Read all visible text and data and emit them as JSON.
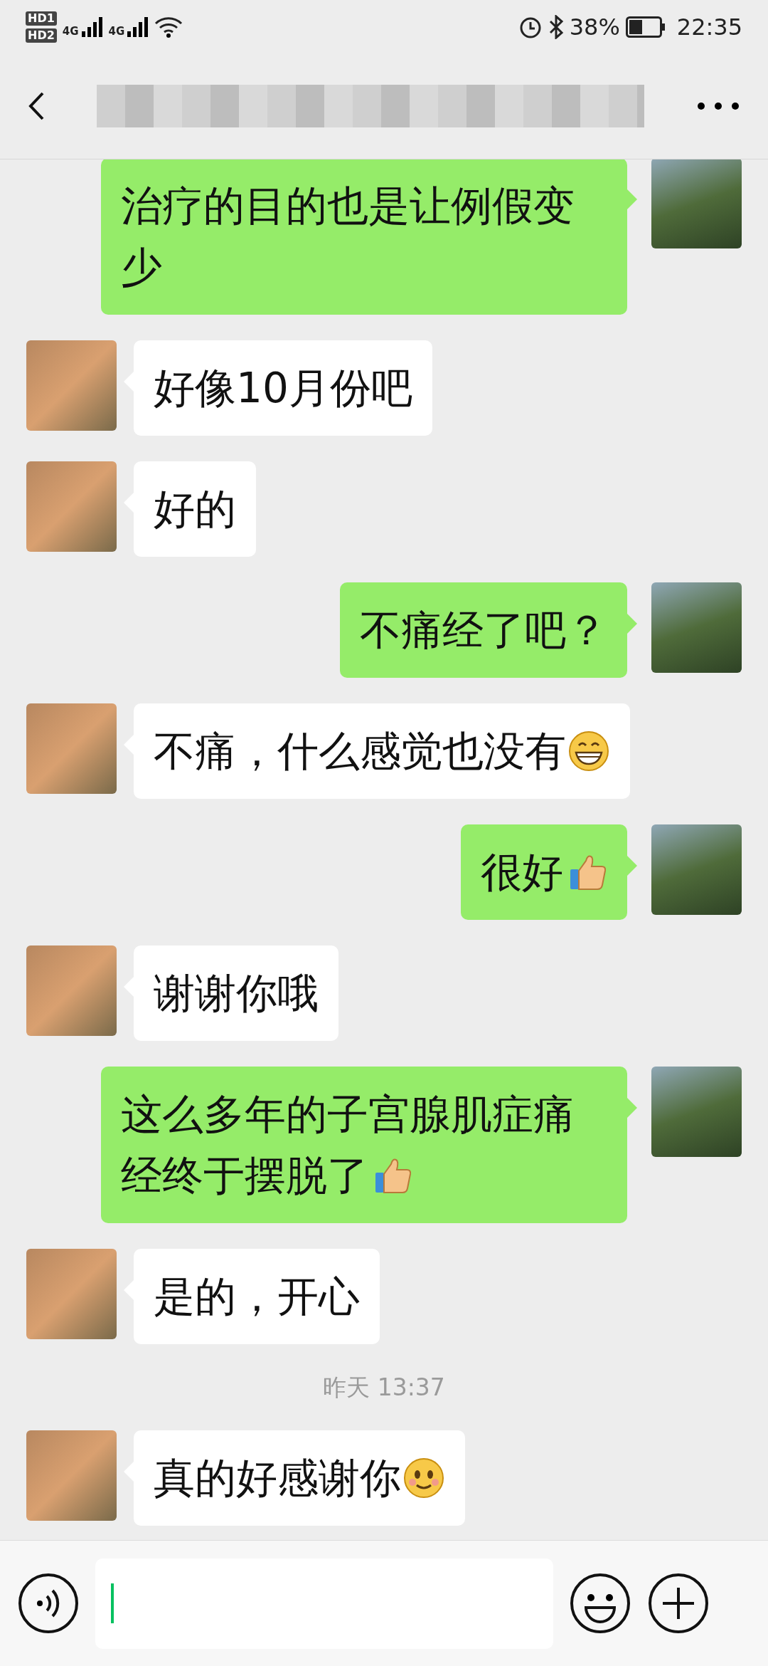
{
  "status_bar": {
    "sim_labels": [
      "HD1",
      "HD2"
    ],
    "networks": [
      "4G",
      "4G"
    ],
    "battery": "38%",
    "time": "22:35"
  },
  "messages": [
    {
      "kind": "sent",
      "parts": [
        {
          "kind": "text",
          "text": "治疗的目的也是让例假变少"
        }
      ]
    },
    {
      "kind": "received",
      "parts": [
        {
          "kind": "text",
          "text": "好像10月份吧"
        }
      ]
    },
    {
      "kind": "received",
      "parts": [
        {
          "kind": "text",
          "text": "好的"
        }
      ]
    },
    {
      "kind": "sent",
      "parts": [
        {
          "kind": "text",
          "text": "不痛经了吧？"
        }
      ]
    },
    {
      "kind": "received",
      "parts": [
        {
          "kind": "text",
          "text": "不痛，什么感觉也没有"
        },
        {
          "kind": "grin"
        }
      ]
    },
    {
      "kind": "sent",
      "parts": [
        {
          "kind": "text",
          "text": "很好"
        },
        {
          "kind": "thumbsup"
        }
      ]
    },
    {
      "kind": "received",
      "parts": [
        {
          "kind": "text",
          "text": "谢谢你哦"
        }
      ]
    },
    {
      "kind": "sent",
      "parts": [
        {
          "kind": "text",
          "text": "这么多年的子宫腺肌症痛经终于摆脱了"
        },
        {
          "kind": "thumbsup"
        }
      ]
    },
    {
      "kind": "received",
      "parts": [
        {
          "kind": "text",
          "text": "是的，开心"
        }
      ]
    },
    {
      "kind": "time",
      "text": "昨天 13:37"
    },
    {
      "kind": "received",
      "parts": [
        {
          "kind": "text",
          "text": "真的好感谢你"
        },
        {
          "kind": "smile"
        }
      ]
    }
  ]
}
